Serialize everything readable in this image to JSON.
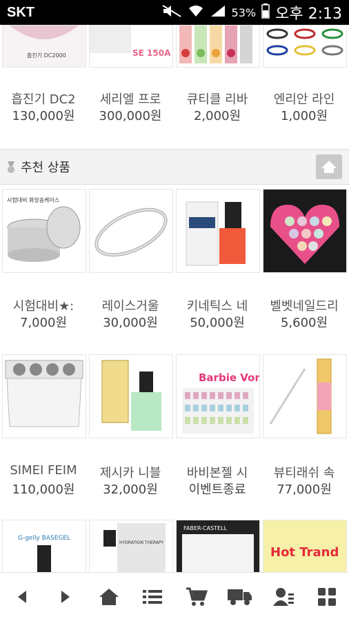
{
  "status_bar": {
    "carrier": "SKT",
    "battery": "53%",
    "time": "오후 2:13"
  },
  "row1_products": [
    {
      "name": "흡진기 DC2",
      "price": "130,000원",
      "image_text": "흡진기 DC2000"
    },
    {
      "name": "세리엘 프로",
      "price": "300,000원",
      "image_text": "SE 150A"
    },
    {
      "name": "큐티클 리바",
      "price": "2,000원",
      "image_text": ""
    },
    {
      "name": "엔리안 라인",
      "price": "1,000원",
      "image_text": ""
    }
  ],
  "recommended_section": {
    "title": "추천 상품"
  },
  "row2_products": [
    {
      "name": "시험대비★:",
      "price": "7,000원",
      "image_text": "시험대비 화장솜케이스"
    },
    {
      "name": "레이스거울",
      "price": "30,000원",
      "image_text": ""
    },
    {
      "name": "키네틱스 네",
      "price": "50,000원",
      "image_text": ""
    },
    {
      "name": "벨벳네일드리",
      "price": "5,600원",
      "image_text": ""
    }
  ],
  "row3_products": [
    {
      "name": "SIMEI FEIM",
      "price": "110,000원",
      "image_text": ""
    },
    {
      "name": "제시카 니블",
      "price": "32,000원",
      "image_text": ""
    },
    {
      "name": "바비본젤 시",
      "price": "이벤트종료",
      "image_text": "Barbie Vongel"
    },
    {
      "name": "뷰티래쉬 속",
      "price": "77,000원",
      "image_text": ""
    }
  ],
  "row4_products": [
    {
      "image_text": "G-gelly BASEGEL"
    },
    {
      "image_text": "HYDRATION THERAPY"
    },
    {
      "image_text": "FABER-CASTELL"
    },
    {
      "image_text": "Hot Trand"
    }
  ],
  "bottom_nav": [
    {
      "icon": "back-arrow-icon"
    },
    {
      "icon": "forward-arrow-icon"
    },
    {
      "icon": "home-icon"
    },
    {
      "icon": "list-icon"
    },
    {
      "icon": "cart-icon"
    },
    {
      "icon": "delivery-truck-icon"
    },
    {
      "icon": "user-profile-icon"
    },
    {
      "icon": "grid-menu-icon"
    }
  ]
}
